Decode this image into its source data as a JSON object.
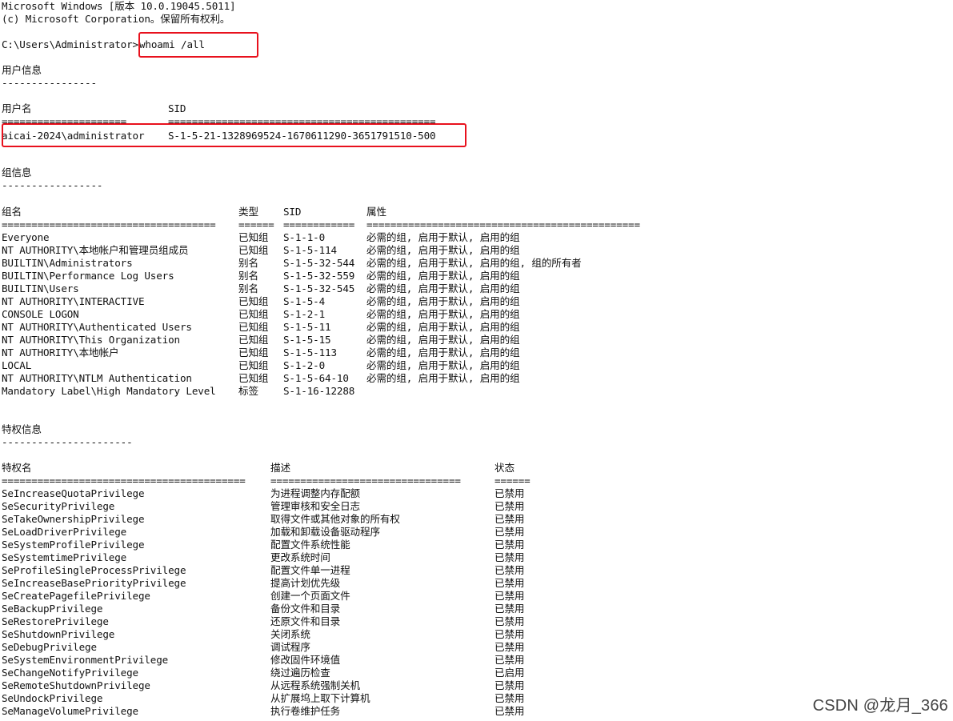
{
  "header": {
    "os_line": "Microsoft Windows [版本 10.0.19045.5011]",
    "copyright_line": "(c) Microsoft Corporation。保留所有权利。"
  },
  "prompt": {
    "path": "C:\\Users\\Administrator>",
    "command": "whoami /all"
  },
  "user_info": {
    "title": "用户信息",
    "underline": "----------------",
    "col_name": "用户名",
    "col_sid": "SID",
    "sep_name": "=====================",
    "sep_sid": "=============================================",
    "user_name": "aicai-2024\\administrator",
    "user_sid": "S-1-5-21-1328969524-1670611290-3651791510-500"
  },
  "group_info": {
    "title": "组信息",
    "underline": "-----------------",
    "col_name": "组名",
    "col_type": "类型",
    "col_sid": "SID",
    "col_attr": "属性",
    "sep_name": "====================================",
    "sep_type": "======",
    "sep_sid": "============",
    "sep_attr": "==============================================",
    "rows": [
      {
        "name": "Everyone",
        "type": "已知组",
        "sid": "S-1-1-0",
        "attr": "必需的组, 启用于默认, 启用的组"
      },
      {
        "name": "NT AUTHORITY\\本地帐户和管理员组成员",
        "type": "已知组",
        "sid": "S-1-5-114",
        "attr": "必需的组, 启用于默认, 启用的组"
      },
      {
        "name": "BUILTIN\\Administrators",
        "type": "别名",
        "sid": "S-1-5-32-544",
        "attr": "必需的组, 启用于默认, 启用的组, 组的所有者"
      },
      {
        "name": "BUILTIN\\Performance Log Users",
        "type": "别名",
        "sid": "S-1-5-32-559",
        "attr": "必需的组, 启用于默认, 启用的组"
      },
      {
        "name": "BUILTIN\\Users",
        "type": "别名",
        "sid": "S-1-5-32-545",
        "attr": "必需的组, 启用于默认, 启用的组"
      },
      {
        "name": "NT AUTHORITY\\INTERACTIVE",
        "type": "已知组",
        "sid": "S-1-5-4",
        "attr": "必需的组, 启用于默认, 启用的组"
      },
      {
        "name": "CONSOLE LOGON",
        "type": "已知组",
        "sid": "S-1-2-1",
        "attr": "必需的组, 启用于默认, 启用的组"
      },
      {
        "name": "NT AUTHORITY\\Authenticated Users",
        "type": "已知组",
        "sid": "S-1-5-11",
        "attr": "必需的组, 启用于默认, 启用的组"
      },
      {
        "name": "NT AUTHORITY\\This Organization",
        "type": "已知组",
        "sid": "S-1-5-15",
        "attr": "必需的组, 启用于默认, 启用的组"
      },
      {
        "name": "NT AUTHORITY\\本地帐户",
        "type": "已知组",
        "sid": "S-1-5-113",
        "attr": "必需的组, 启用于默认, 启用的组"
      },
      {
        "name": "LOCAL",
        "type": "已知组",
        "sid": "S-1-2-0",
        "attr": "必需的组, 启用于默认, 启用的组"
      },
      {
        "name": "NT AUTHORITY\\NTLM Authentication",
        "type": "已知组",
        "sid": "S-1-5-64-10",
        "attr": "必需的组, 启用于默认, 启用的组"
      },
      {
        "name": "Mandatory Label\\High Mandatory Level",
        "type": "标签",
        "sid": "S-1-16-12288",
        "attr": ""
      }
    ]
  },
  "privilege_info": {
    "title": "特权信息",
    "underline": "----------------------",
    "col_name": "特权名",
    "col_desc": "描述",
    "col_state": "状态",
    "sep_name": "=========================================",
    "sep_desc": "================================",
    "sep_state": "======",
    "rows": [
      {
        "name": "SeIncreaseQuotaPrivilege",
        "desc": "为进程调整内存配额",
        "state": "已禁用"
      },
      {
        "name": "SeSecurityPrivilege",
        "desc": "管理审核和安全日志",
        "state": "已禁用"
      },
      {
        "name": "SeTakeOwnershipPrivilege",
        "desc": "取得文件或其他对象的所有权",
        "state": "已禁用"
      },
      {
        "name": "SeLoadDriverPrivilege",
        "desc": "加载和卸载设备驱动程序",
        "state": "已禁用"
      },
      {
        "name": "SeSystemProfilePrivilege",
        "desc": "配置文件系统性能",
        "state": "已禁用"
      },
      {
        "name": "SeSystemtimePrivilege",
        "desc": "更改系统时间",
        "state": "已禁用"
      },
      {
        "name": "SeProfileSingleProcessPrivilege",
        "desc": "配置文件单一进程",
        "state": "已禁用"
      },
      {
        "name": "SeIncreaseBasePriorityPrivilege",
        "desc": "提高计划优先级",
        "state": "已禁用"
      },
      {
        "name": "SeCreatePagefilePrivilege",
        "desc": "创建一个页面文件",
        "state": "已禁用"
      },
      {
        "name": "SeBackupPrivilege",
        "desc": "备份文件和目录",
        "state": "已禁用"
      },
      {
        "name": "SeRestorePrivilege",
        "desc": "还原文件和目录",
        "state": "已禁用"
      },
      {
        "name": "SeShutdownPrivilege",
        "desc": "关闭系统",
        "state": "已禁用"
      },
      {
        "name": "SeDebugPrivilege",
        "desc": "调试程序",
        "state": "已禁用"
      },
      {
        "name": "SeSystemEnvironmentPrivilege",
        "desc": "修改固件环境值",
        "state": "已禁用"
      },
      {
        "name": "SeChangeNotifyPrivilege",
        "desc": "绕过遍历检查",
        "state": "已启用"
      },
      {
        "name": "SeRemoteShutdownPrivilege",
        "desc": "从远程系统强制关机",
        "state": "已禁用"
      },
      {
        "name": "SeUndockPrivilege",
        "desc": "从扩展坞上取下计算机",
        "state": "已禁用"
      },
      {
        "name": "SeManageVolumePrivilege",
        "desc": "执行卷维护任务",
        "state": "已禁用"
      }
    ]
  },
  "watermark": "CSDN @龙月_366",
  "colors": {
    "highlight": "#e8111d",
    "text": "#111111",
    "background": "#ffffff"
  }
}
